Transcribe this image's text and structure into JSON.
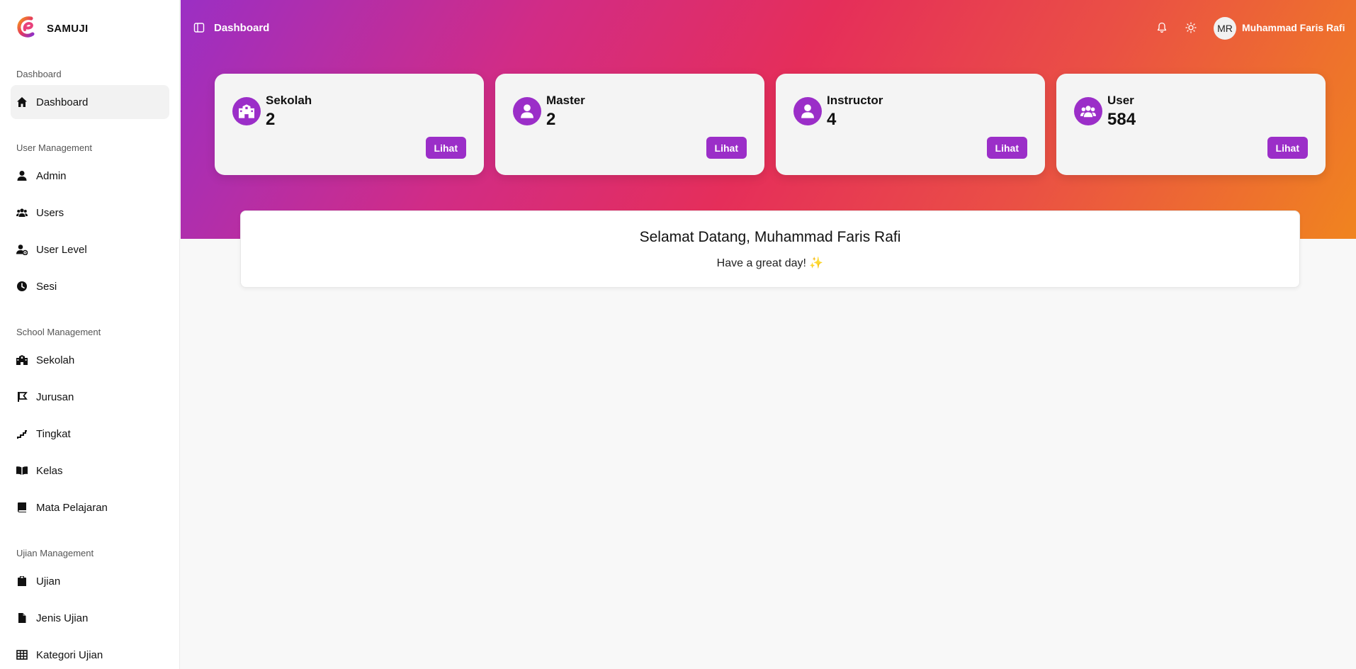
{
  "brand": {
    "name": "SAMUJI",
    "logo": "samuji-logo"
  },
  "sidebar": {
    "sections": [
      {
        "title": "Dashboard",
        "items": [
          {
            "label": "Dashboard",
            "icon": "home-icon",
            "active": true
          }
        ]
      },
      {
        "title": "User Management",
        "items": [
          {
            "label": "Admin",
            "icon": "user-icon"
          },
          {
            "label": "Users",
            "icon": "users-icon"
          },
          {
            "label": "User Level",
            "icon": "user-gear-icon"
          },
          {
            "label": "Sesi",
            "icon": "clock-icon"
          }
        ]
      },
      {
        "title": "School Management",
        "items": [
          {
            "label": "Sekolah",
            "icon": "school-icon"
          },
          {
            "label": "Jurusan",
            "icon": "flag-icon"
          },
          {
            "label": "Tingkat",
            "icon": "stairs-icon"
          },
          {
            "label": "Kelas",
            "icon": "book-open-icon"
          },
          {
            "label": "Mata Pelajaran",
            "icon": "book-icon"
          }
        ]
      },
      {
        "title": "Ujian Management",
        "items": [
          {
            "label": "Ujian",
            "icon": "clipboard-icon"
          },
          {
            "label": "Jenis Ujian",
            "icon": "file-icon"
          },
          {
            "label": "Kategori Ujian",
            "icon": "table-icon"
          }
        ]
      }
    ]
  },
  "header": {
    "title": "Dashboard",
    "user": {
      "initials": "MR",
      "name": "Muhammad Faris Rafi"
    }
  },
  "stats": [
    {
      "label": "Sekolah",
      "value": "2",
      "button": "Lihat",
      "icon": "school-icon"
    },
    {
      "label": "Master",
      "value": "2",
      "button": "Lihat",
      "icon": "user-icon"
    },
    {
      "label": "Instructor",
      "value": "4",
      "button": "Lihat",
      "icon": "user-icon"
    },
    {
      "label": "User",
      "value": "584",
      "button": "Lihat",
      "icon": "users-icon"
    }
  ],
  "welcome": {
    "title": "Selamat Datang, Muhammad Faris Rafi",
    "subtitle": "Have a great day! ✨"
  },
  "colors": {
    "accent": "#9b2ec8",
    "gradient_start": "#9b2fc4",
    "gradient_mid": "#e52e5a",
    "gradient_end": "#f0841f"
  }
}
